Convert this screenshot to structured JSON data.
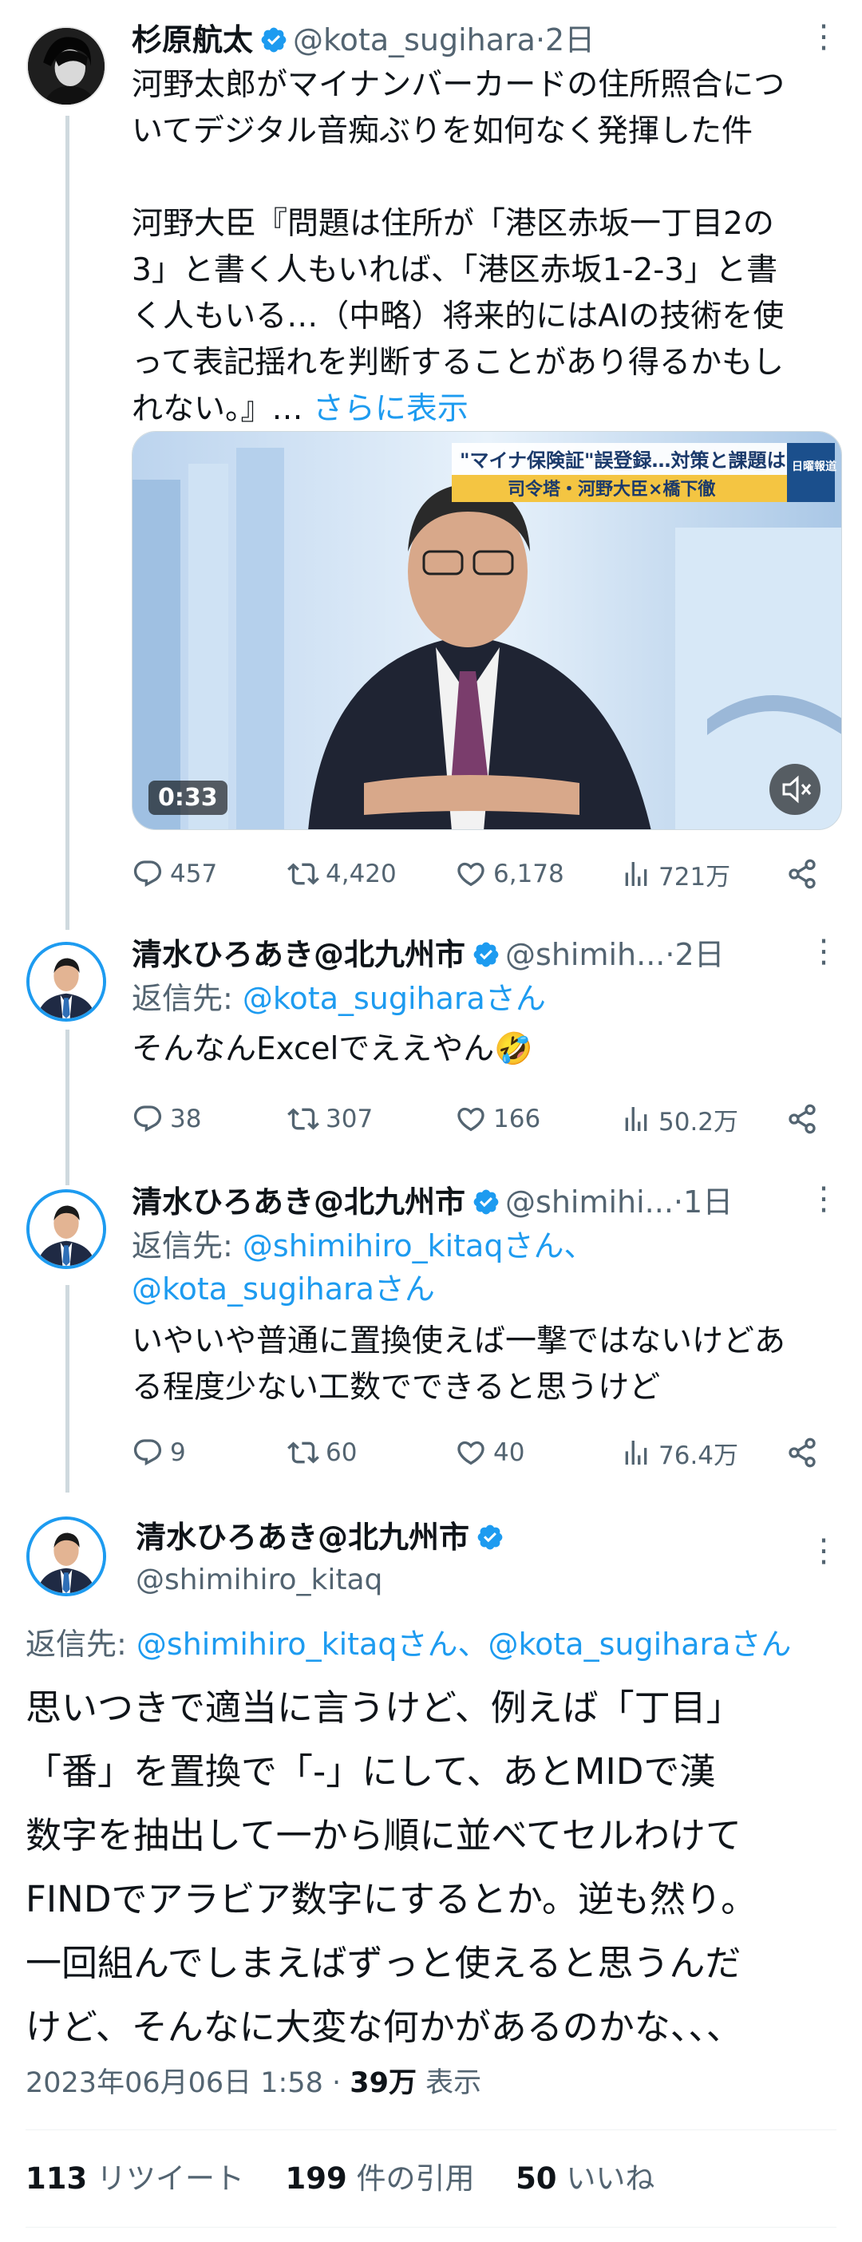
{
  "tweet1": {
    "name": "杉原航太",
    "handle": "@kota_sugihara",
    "dot": "·",
    "time": "2日",
    "lines": [
      "河野太郎がマイナンバーカードの住所照合につ",
      "いてデジタル音痴ぶりを如何なく発揮した件",
      "",
      "河野大臣『問題は住所が「港区赤坂一丁目2の",
      "3」と書く人もいれば、「港区赤坂1-2-3」と書",
      "く人もいる…（中略）将来的にはAIの技術を使",
      "って表記揺れを判断することがあり得るかもし"
    ],
    "last_line": "れない。』…",
    "show_more": "さらに表示",
    "video_time": "0:33",
    "video_caption_top": "\"マイナ保険証\"誤登録…対策と課題は",
    "video_caption_sub": "司令塔・河野大臣×橋下徹",
    "video_logo": "日曜報道",
    "replies": "457",
    "retweets": "4,420",
    "likes": "6,178",
    "views": "721万"
  },
  "tweet2": {
    "name": "清水ひろあき@北九州市",
    "handle": "@shimih...",
    "dot": "·",
    "time": "2日",
    "reply_prefix": "返信先:",
    "reply_to": "@kota_sugiharaさん",
    "text": "そんなんExcelでええやん🤣",
    "replies": "38",
    "retweets": "307",
    "likes": "166",
    "views": "50.2万"
  },
  "tweet3": {
    "name": "清水ひろあき@北九州市",
    "handle": "@shimihi...",
    "dot": "·",
    "time": "1日",
    "reply_prefix": "返信先:",
    "reply_to_1": "@shimihiro_kitaqさん、",
    "reply_to_2": "@kota_sugiharaさん",
    "line1": "いやいや普通に置換使えば一撃ではないけどあ",
    "line2": "る程度少ない工数でできると思うけど",
    "replies": "9",
    "retweets": "60",
    "likes": "40",
    "views": "76.4万"
  },
  "main": {
    "name": "清水ひろあき@北九州市",
    "handle": "@shimihiro_kitaq",
    "reply_prefix": "返信先:",
    "reply_to_1": "@shimihiro_kitaqさん",
    "reply_sep": "、",
    "reply_to_2": "@kota_sugiharaさん",
    "lines": [
      "思いつきで適当に言うけど、例えば「丁目」",
      "「番」を置換で「-」にして、あとMIDで漢",
      "数字を抽出して一から順に並べてセルわけて",
      "FINDでアラビア数字にするとか。逆も然り。",
      "一回組んでしまえばずっと使えると思うんだ",
      "けど、そんなに大変な何かがあるのかな、、、"
    ],
    "timestamp": "2023年06月06日 1:58",
    "meta_dot": "·",
    "views_count": "39万",
    "views_label": "表示",
    "retweets_count": "113",
    "retweets_label": "リツイート",
    "quotes_count": "199",
    "quotes_label": "件の引用",
    "likes_count": "50",
    "likes_label": "いいね"
  },
  "colors": {
    "accent": "#1d9bf0",
    "text": "#0f1419",
    "muted": "#536471",
    "line": "#cfd9de"
  }
}
